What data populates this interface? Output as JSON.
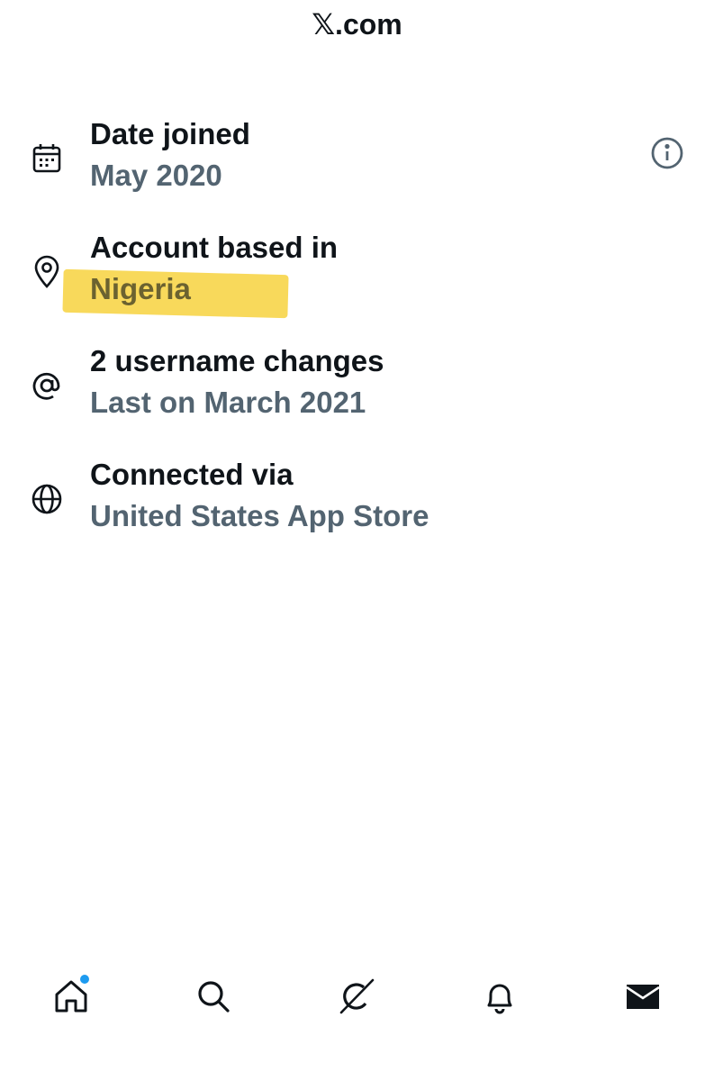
{
  "header": {
    "url": "𝕏.com"
  },
  "info_rows": [
    {
      "icon": "calendar-icon",
      "label": "Date joined",
      "value": "May 2020"
    },
    {
      "icon": "location-pin-icon",
      "label": "Account based in",
      "value": "Nigeria",
      "highlighted": true,
      "highlight_color": "#f7d23e"
    },
    {
      "icon": "at-sign-icon",
      "label": "2 username changes",
      "value": "Last on March 2021"
    },
    {
      "icon": "globe-icon",
      "label": "Connected via",
      "value": "United States App Store"
    }
  ],
  "bottom_nav": {
    "items": [
      "home-icon",
      "search-icon",
      "grok-icon",
      "notifications-bell-icon",
      "messages-envelope-icon"
    ],
    "home_has_notification": true,
    "notification_dot_color": "#1d9bf0"
  },
  "colors": {
    "primary_text": "#0f1419",
    "secondary_text": "#536471",
    "background": "#ffffff"
  }
}
